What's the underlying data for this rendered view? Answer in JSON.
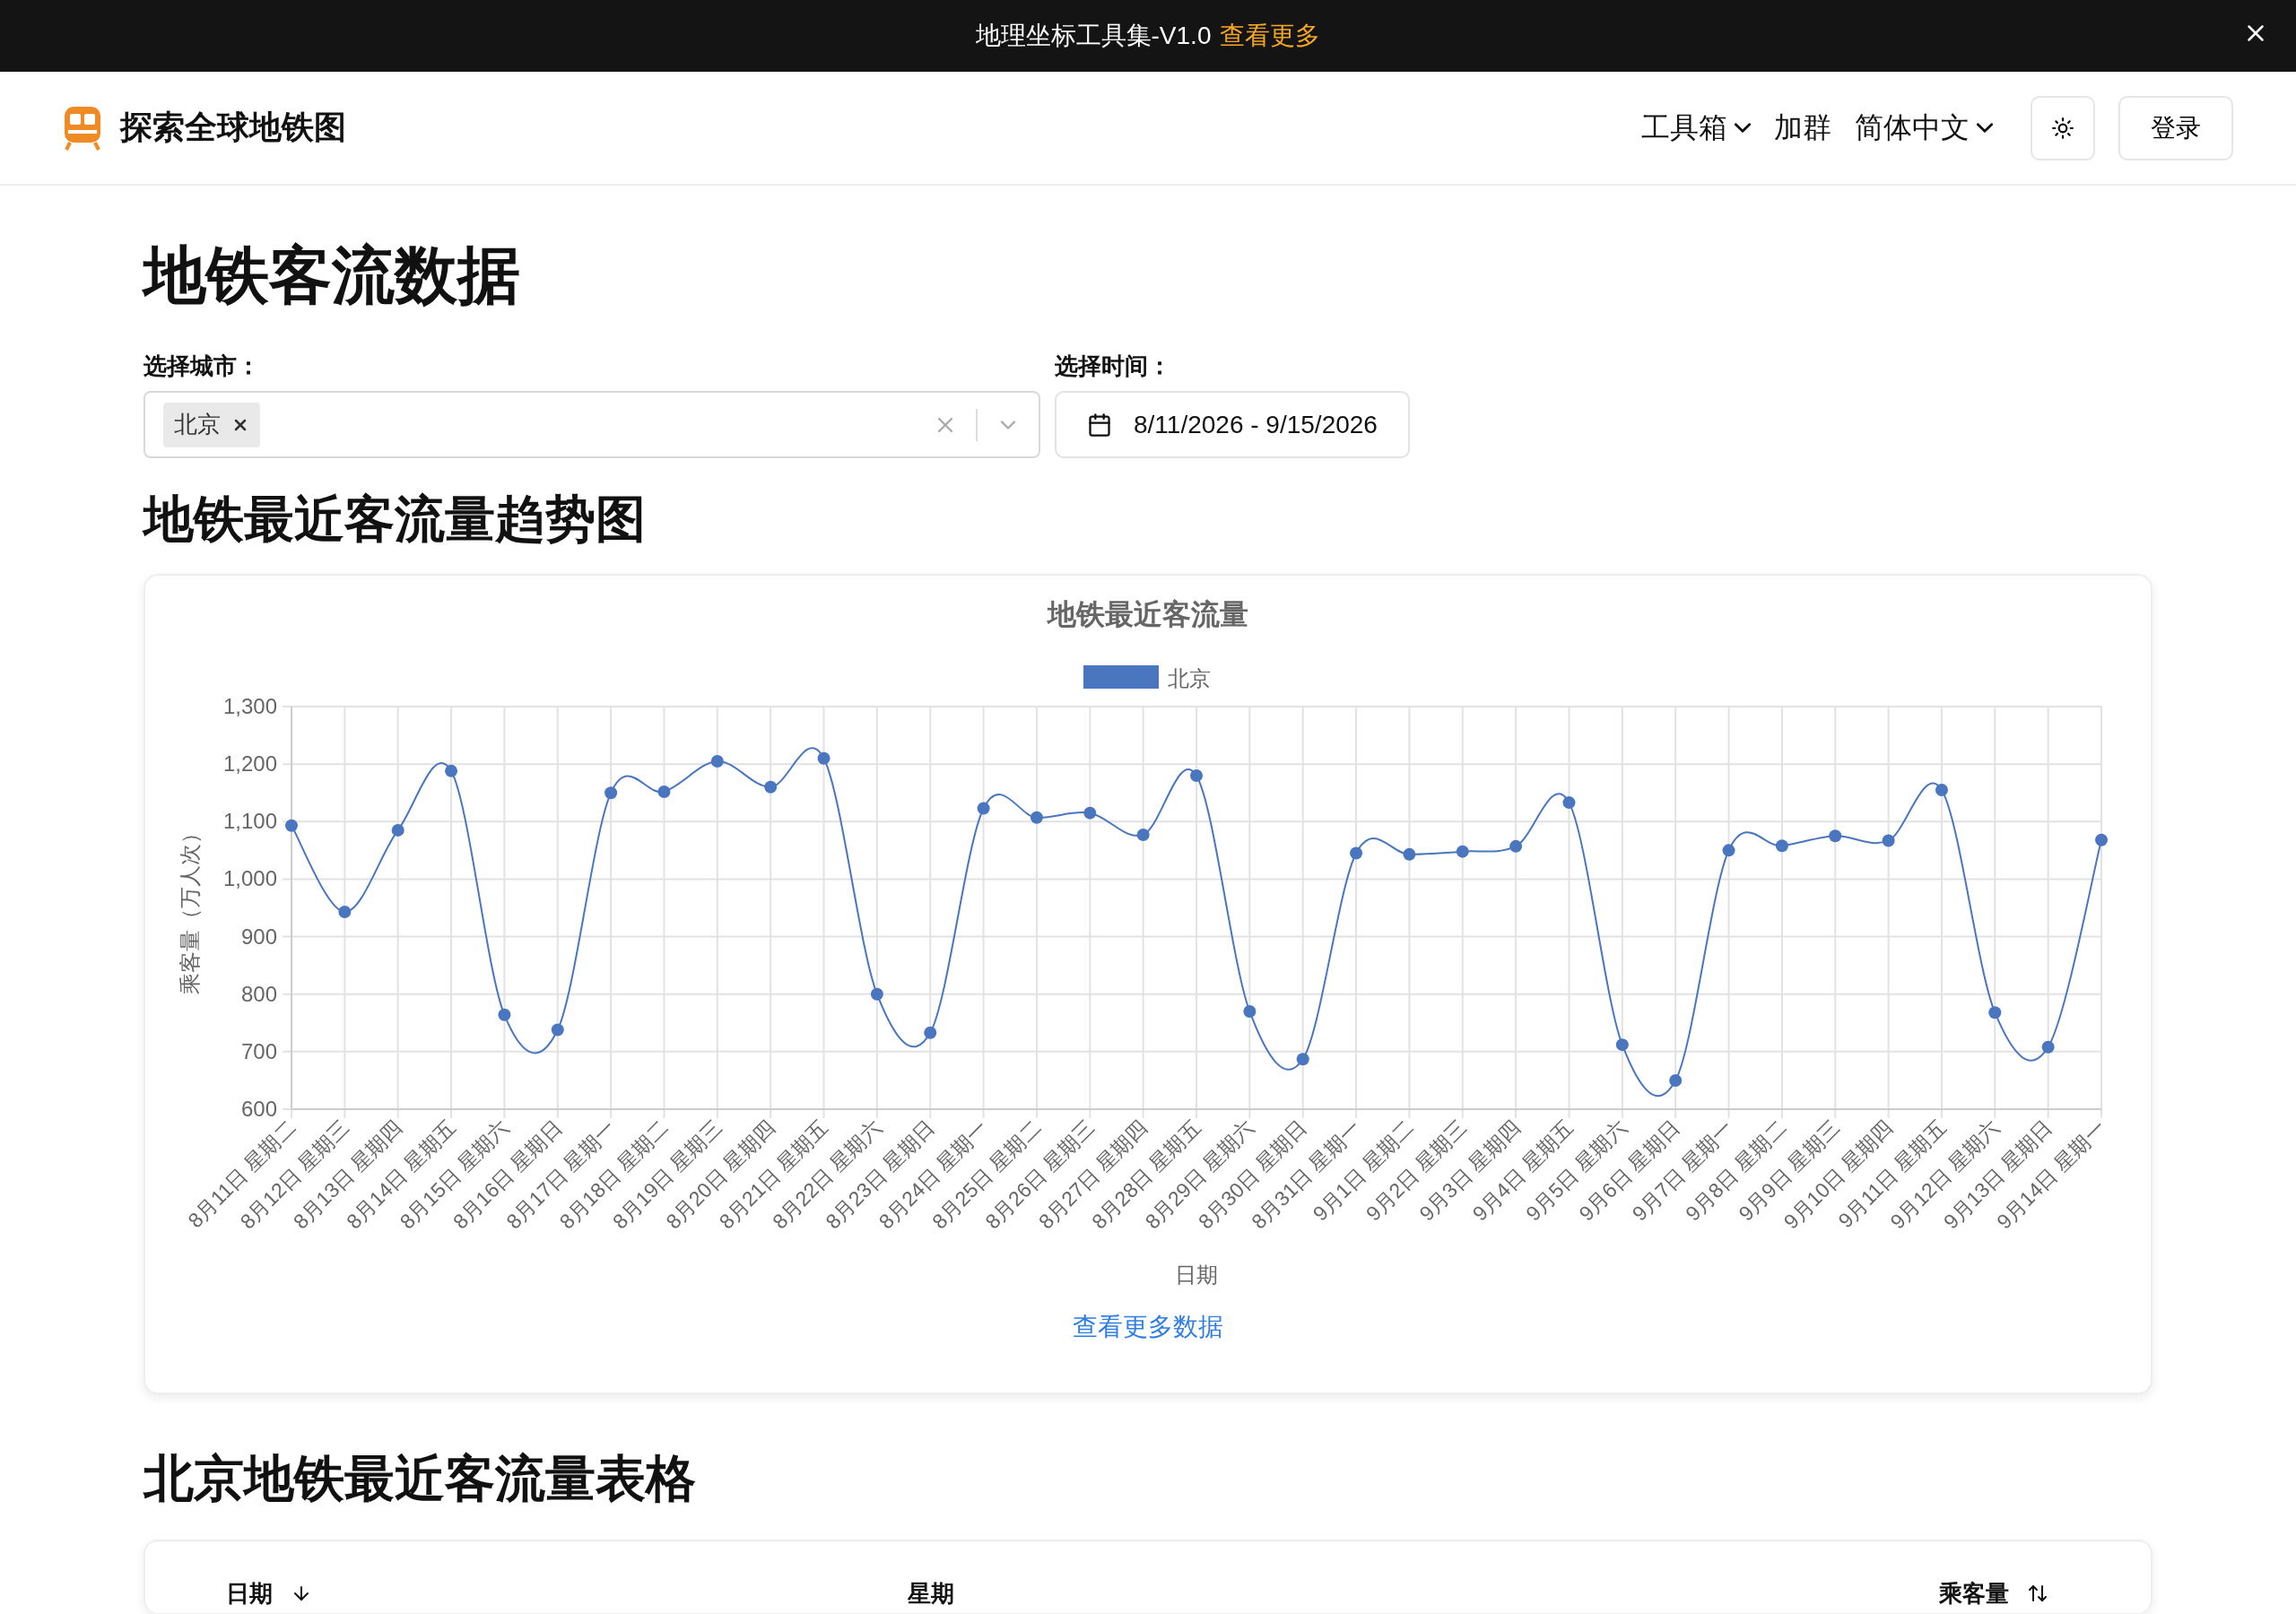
{
  "announcement": {
    "text": "地理坐标工具集-V1.0",
    "link": "查看更多"
  },
  "header": {
    "brand": "探索全球地铁图",
    "nav": [
      {
        "label": "工具箱",
        "dropdown": true
      },
      {
        "label": "加群",
        "dropdown": false
      },
      {
        "label": "简体中文",
        "dropdown": true
      }
    ],
    "login": "登录"
  },
  "page_title": "地铁客流数据",
  "filters": {
    "city_label": "选择城市：",
    "city_tags": [
      "北京"
    ],
    "time_label": "选择时间：",
    "date_range": "8/11/2026 - 9/15/2026"
  },
  "chart_section": {
    "heading": "地铁最近客流量趋势图",
    "more_link": "查看更多数据",
    "chart_data": {
      "type": "line",
      "title": "地铁最近客流量",
      "xlabel": "日期",
      "ylabel": "乘客量（万人次）",
      "categories": [
        "8月11日 星期二",
        "8月12日 星期三",
        "8月13日 星期四",
        "8月14日 星期五",
        "8月15日 星期六",
        "8月16日 星期日",
        "8月17日 星期一",
        "8月18日 星期二",
        "8月19日 星期三",
        "8月20日 星期四",
        "8月21日 星期五",
        "8月22日 星期六",
        "8月23日 星期日",
        "8月24日 星期一",
        "8月25日 星期二",
        "8月26日 星期三",
        "8月27日 星期四",
        "8月28日 星期五",
        "8月29日 星期六",
        "8月30日 星期日",
        "8月31日 星期一",
        "9月1日 星期二",
        "9月2日 星期三",
        "9月3日 星期四",
        "9月4日 星期五",
        "9月5日 星期六",
        "9月6日 星期日",
        "9月7日 星期一",
        "9月8日 星期二",
        "9月9日 星期三",
        "9月10日 星期四",
        "9月11日 星期五",
        "9月12日 星期六",
        "9月13日 星期日",
        "9月14日 星期一"
      ],
      "series": [
        {
          "name": "北京",
          "color": "#4a76c0",
          "marker": true,
          "values": [
            1093,
            943,
            1085,
            1188,
            764,
            738,
            1150,
            1152,
            1205,
            1160,
            1210,
            800,
            733,
            1123,
            1107,
            1115,
            1077,
            1180,
            770,
            687,
            1045,
            1043,
            1048,
            1057,
            1133,
            712,
            650,
            1050,
            1058,
            1075,
            1067,
            1155,
            768,
            708,
            1068
          ]
        }
      ],
      "grid": true,
      "ylim": [
        600,
        1300
      ],
      "yticks": [
        {
          "value": 600,
          "label": "600"
        },
        {
          "value": 700,
          "label": "700"
        },
        {
          "value": 800,
          "label": "800"
        },
        {
          "value": 900,
          "label": "900"
        },
        {
          "value": 1000,
          "label": "1,000"
        },
        {
          "value": 1100,
          "label": "1,100"
        },
        {
          "value": 1200,
          "label": "1,200"
        },
        {
          "value": 1300,
          "label": "1,300"
        }
      ]
    }
  },
  "table_section": {
    "heading": "北京地铁最近客流量表格",
    "columns": [
      {
        "label": "日期",
        "sortable": true,
        "sorted": true
      },
      {
        "label": "星期",
        "sortable": false
      },
      {
        "label": "乘客量",
        "sortable": true,
        "sorted": false
      }
    ]
  }
}
